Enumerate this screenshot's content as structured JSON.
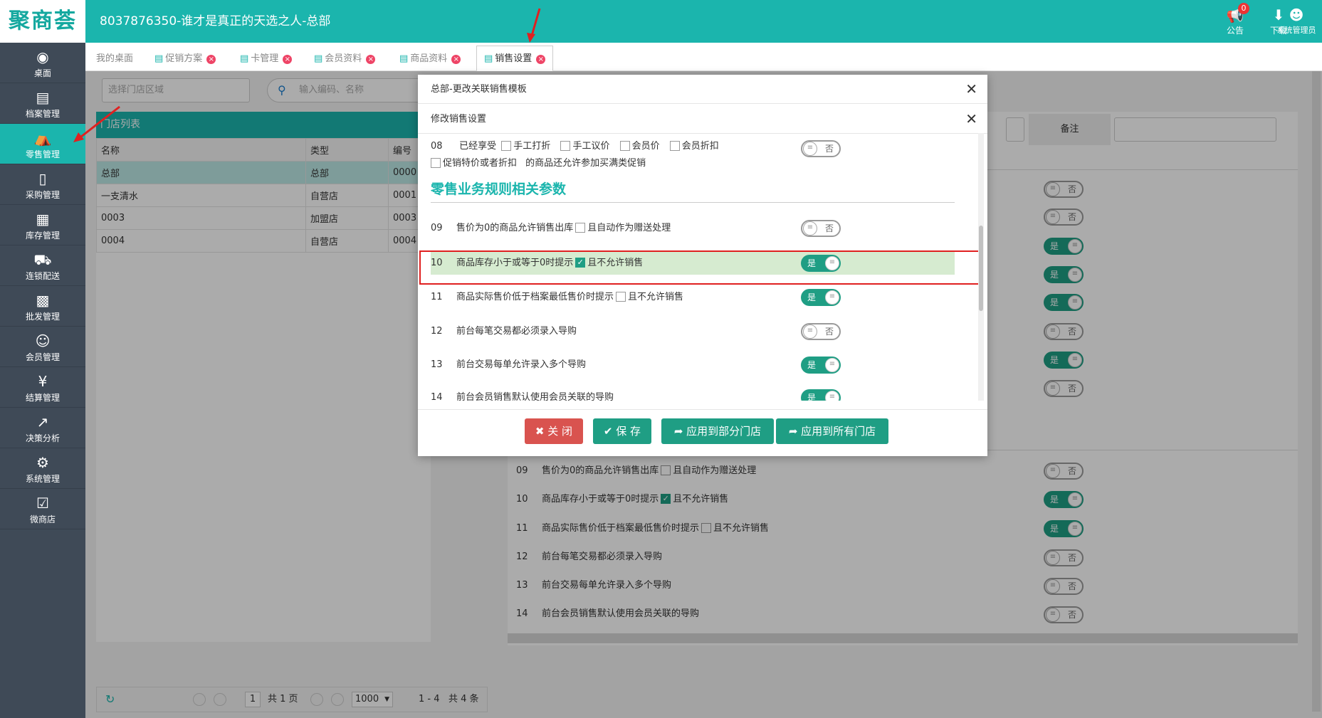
{
  "header": {
    "logo": "聚商荟",
    "title": "8037876350-谁才是真正的天选之人-总部",
    "notice_label": "公告",
    "notice_count": "0",
    "download_label": "下载",
    "user_label": "系统管理员"
  },
  "sidebar": {
    "items": [
      {
        "label": "桌面",
        "icon": "dashboard-icon"
      },
      {
        "label": "档案管理",
        "icon": "file-icon"
      },
      {
        "label": "零售管理",
        "icon": "store-icon"
      },
      {
        "label": "采购管理",
        "icon": "cart-icon"
      },
      {
        "label": "库存管理",
        "icon": "inventory-icon"
      },
      {
        "label": "连锁配送",
        "icon": "truck-icon"
      },
      {
        "label": "批发管理",
        "icon": "wholesale-icon"
      },
      {
        "label": "会员管理",
        "icon": "member-icon"
      },
      {
        "label": "结算管理",
        "icon": "settlement-icon"
      },
      {
        "label": "决策分析",
        "icon": "chart-icon"
      },
      {
        "label": "系统管理",
        "icon": "gear-icon"
      },
      {
        "label": "微商店",
        "icon": "shop-bag-icon"
      }
    ]
  },
  "tabs": [
    {
      "label": "我的桌面"
    },
    {
      "label": "促销方案"
    },
    {
      "label": "卡管理"
    },
    {
      "label": "会员资料"
    },
    {
      "label": "商品资料"
    },
    {
      "label": "销售设置"
    }
  ],
  "filter": {
    "store_area_placeholder": "选择门店区域",
    "search_placeholder": "输入编码、名称",
    "remark_label": "备注"
  },
  "store_list": {
    "title": "门店列表",
    "columns": [
      "名称",
      "类型",
      "编号"
    ],
    "rows": [
      [
        "总部",
        "总部",
        "0000"
      ],
      [
        "一支清水",
        "自营店",
        "0001"
      ],
      [
        "0003",
        "加盟店",
        "0003"
      ],
      [
        "0004",
        "自营店",
        "0004"
      ]
    ]
  },
  "pager": {
    "page": "1",
    "total_pages": "共 1 页",
    "page_size": "1000",
    "range": "1 - 4",
    "total": "共 4 条"
  },
  "background_rules": [
    {
      "num": "09",
      "text": "售价为0的商品允许销售出库",
      "extra": "且自动作为赠送处理",
      "checked": false,
      "value": "否"
    },
    {
      "num": "10",
      "text": "商品库存小于或等于0时提示",
      "extra": "且不允许销售",
      "checked": true,
      "value": "是"
    },
    {
      "num": "11",
      "text": "商品实际售价低于档案最低售价时提示",
      "extra": "且不允许销售",
      "checked": false,
      "value": "是"
    },
    {
      "num": "12",
      "text": "前台每笔交易都必须录入导购",
      "extra": "",
      "value": "否"
    },
    {
      "num": "13",
      "text": "前台交易每单允许录入多个导购",
      "extra": "",
      "value": "否"
    },
    {
      "num": "14",
      "text": "前台会员销售默认使用会员关联的导购",
      "extra": "",
      "value": "否"
    }
  ],
  "background_switches_upper": [
    "否",
    "否",
    "是",
    "是",
    "是",
    "否",
    "是",
    "否"
  ],
  "modal": {
    "outer_title": "总部-更改关联销售模板",
    "inner_title": "修改销售设置",
    "row08": {
      "num": "08",
      "prefix": "已经享受",
      "options": [
        "手工打折",
        "手工议价",
        "会员价",
        "会员折扣"
      ],
      "line2_checkbox": "促销特价或者折扣",
      "line2_text": "的商品还允许参加买满类促销",
      "value": "否"
    },
    "section_title": "零售业务规则相关参数",
    "rules": [
      {
        "num": "09",
        "text": "售价为0的商品允许销售出库",
        "extra": "且自动作为赠送处理",
        "checked": false,
        "value": "否"
      },
      {
        "num": "10",
        "text": "商品库存小于或等于0时提示",
        "extra": "且不允许销售",
        "checked": true,
        "value": "是"
      },
      {
        "num": "11",
        "text": "商品实际售价低于档案最低售价时提示",
        "extra": "且不允许销售",
        "checked": false,
        "value": "是"
      },
      {
        "num": "12",
        "text": "前台每笔交易都必须录入导购",
        "extra": "",
        "value": "否"
      },
      {
        "num": "13",
        "text": "前台交易每单允许录入多个导购",
        "extra": "",
        "value": "是"
      },
      {
        "num": "14",
        "text": "前台会员销售默认使用会员关联的导购",
        "extra": "",
        "value": "是"
      }
    ],
    "buttons": {
      "close": "关 闭",
      "save": "保 存",
      "apply_some": "应用到部分门店",
      "apply_all": "应用到所有门店"
    }
  },
  "colors": {
    "brand": "#1bb5ad",
    "sidebar": "#3f4a57",
    "switch_on": "#1f9e84",
    "close_button": "#d9534f",
    "highlight_row": "#d6ebd0",
    "annotation": "#e02020"
  }
}
